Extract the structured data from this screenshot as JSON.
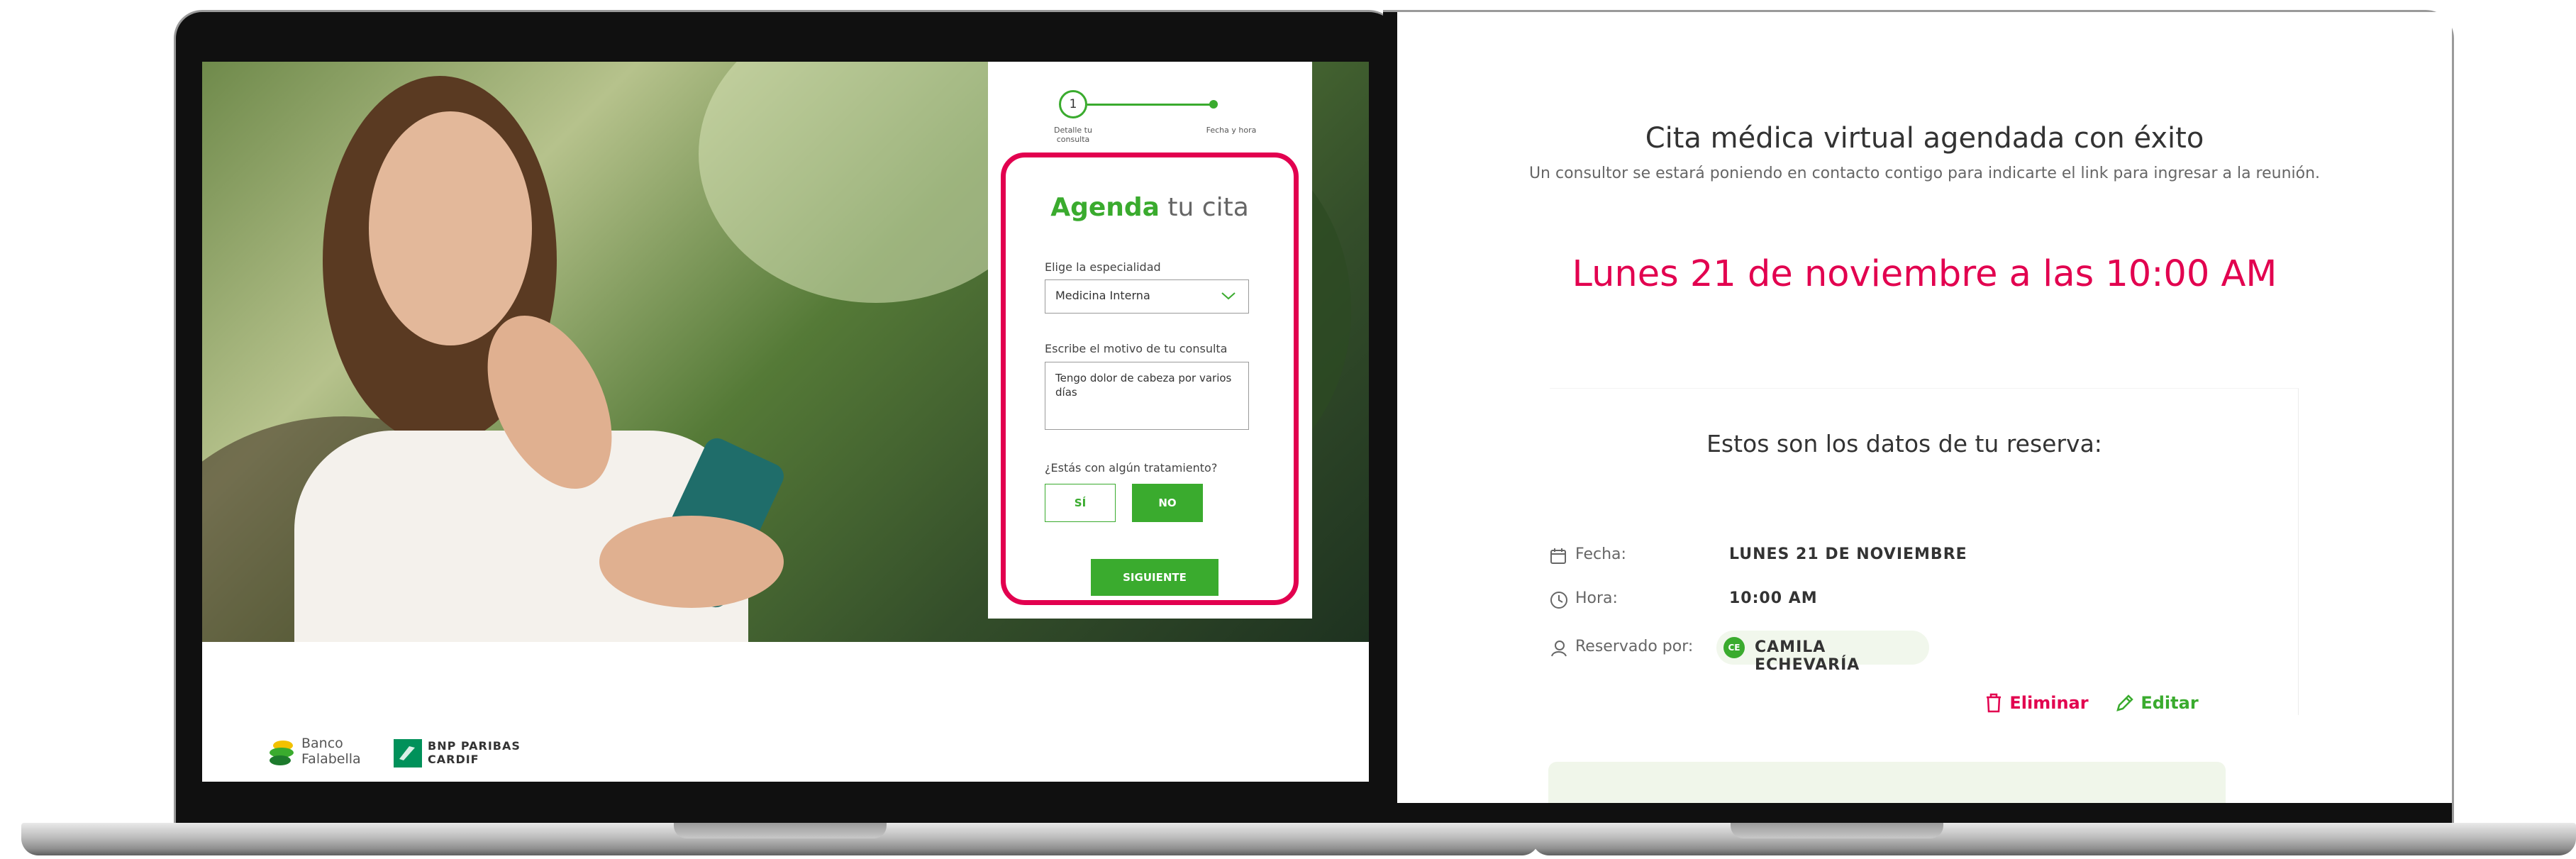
{
  "left_screen": {
    "stepper": {
      "step_number": "1",
      "step1_label": "Detalle tu consulta",
      "step2_label": "Fecha y hora"
    },
    "form": {
      "title_accent": "Agenda",
      "title_rest": " tu cita",
      "specialty_label": "Elige la especialidad",
      "specialty_value": "Medicina Interna",
      "reason_label": "Escribe el motivo de tu consulta",
      "reason_value": "Tengo dolor de cabeza por varios días",
      "treatment_question": "¿Estás con algún tratamiento?",
      "option_yes": "SÍ",
      "option_no": "NO",
      "selected_option": "NO",
      "next_button": "SIGUIENTE"
    },
    "footer": {
      "banco_line1": "Banco",
      "banco_line2": "Falabella",
      "bnp_line1": "BNP PARIBAS",
      "bnp_line2": "CARDIF"
    }
  },
  "right_screen": {
    "title": "Cita médica virtual agendada con éxito",
    "subtitle": "Un consultor se estará poniendo en contacto contigo para indicarte el link para ingresar a la reunión.",
    "appointment_datetime": "Lunes 21 de noviembre a las 10:00 AM",
    "card": {
      "heading": "Estos son los datos de tu reserva:",
      "date_label": "Fecha:",
      "date_value": "LUNES 21 DE NOVIEMBRE",
      "time_label": "Hora:",
      "time_value": "10:00 AM",
      "reserved_label": "Reservado por:",
      "user_initials": "CE",
      "user_name": "CAMILA ECHEVARÍA",
      "delete_label": "Eliminar",
      "edit_label": "Editar"
    }
  },
  "colors": {
    "brand_green": "#3aab2e",
    "accent_magenta": "#e2004f"
  },
  "icons": [
    "chevron-down-icon",
    "calendar-icon",
    "clock-icon",
    "user-icon",
    "trash-icon",
    "pencil-icon"
  ]
}
